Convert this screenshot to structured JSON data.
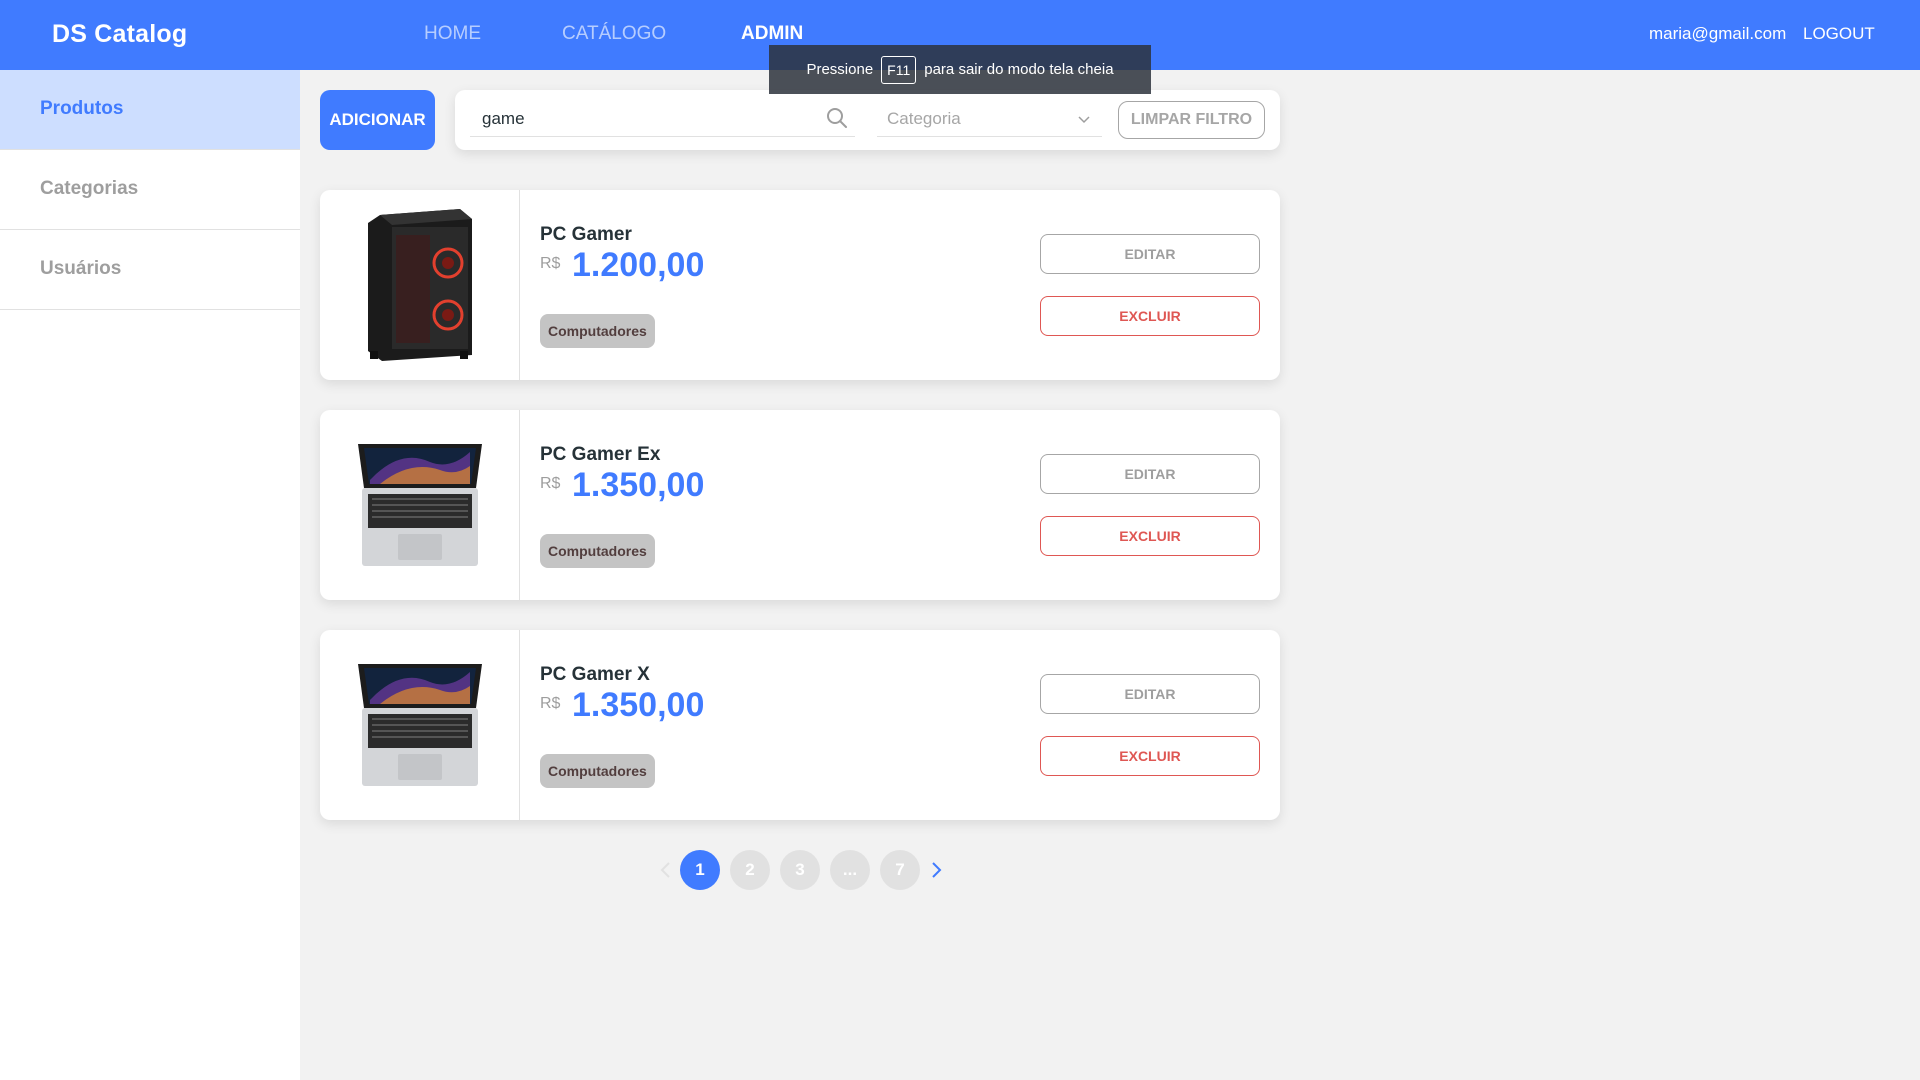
{
  "navbar": {
    "brand": "DS Catalog",
    "links": [
      "HOME",
      "CATÁLOGO",
      "ADMIN"
    ],
    "active_link": "ADMIN",
    "user_email": "maria@gmail.com",
    "logout": "LOGOUT"
  },
  "fullscreen_toast": {
    "before": "Pressione",
    "key": "F11",
    "after": "para sair do modo tela cheia"
  },
  "sidebar": {
    "items": [
      "Produtos",
      "Categorias",
      "Usuários"
    ],
    "active": "Produtos"
  },
  "toolbar": {
    "add_label": "ADICIONAR",
    "search_value": "game",
    "search_icon": "search-icon",
    "category_placeholder": "Categoria",
    "clear_label": "LIMPAR FILTRO"
  },
  "products": [
    {
      "name": "PC Gamer",
      "currency": "R$",
      "price": "1.200,00",
      "category": "Computadores",
      "image": "pc-tower-image",
      "edit_label": "EDITAR",
      "delete_label": "EXCLUIR"
    },
    {
      "name": "PC Gamer Ex",
      "currency": "R$",
      "price": "1.350,00",
      "category": "Computadores",
      "image": "laptop-image",
      "edit_label": "EDITAR",
      "delete_label": "EXCLUIR"
    },
    {
      "name": "PC Gamer X",
      "currency": "R$",
      "price": "1.350,00",
      "category": "Computadores",
      "image": "laptop-image",
      "edit_label": "EDITAR",
      "delete_label": "EXCLUIR"
    }
  ],
  "pagination": {
    "pages": [
      "1",
      "2",
      "3",
      "...",
      "7"
    ],
    "active": "1"
  },
  "colors": {
    "primary": "#407bff",
    "danger": "#df5753",
    "sidebar_active_bg": "#cddeff",
    "page_bg": "#f2f2f2",
    "badge_bg": "#c4c4c4"
  }
}
